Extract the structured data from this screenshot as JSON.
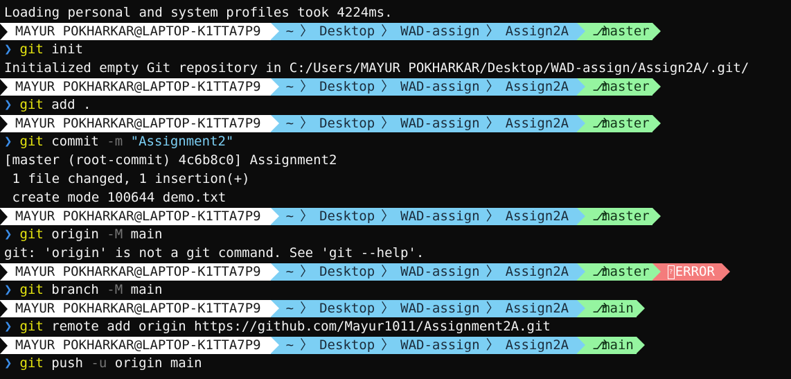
{
  "terminal": {
    "startup": "Loading personal and system profiles took 4224ms.",
    "prompt": {
      "user": "MAYUR POKHARKAR@LAPTOP-K1TTA7P9",
      "home": "~",
      "path": [
        "Desktop",
        "WAD-assign",
        "Assign2A"
      ],
      "prompt_symbol": "❯"
    },
    "colors": {
      "user_segment": "#ffffff",
      "path_segment": "#7ccff4",
      "git_segment": "#95f5a0",
      "error_segment": "#f47c7c",
      "git_command": "#e5e510",
      "prompt_chevron": "#3b8eea"
    },
    "branches": {
      "master": "master",
      "main": "main"
    },
    "error_label": "ERROR",
    "commands": {
      "c1": {
        "git": "git",
        "rest": " init"
      },
      "c2": {
        "git": "git",
        "rest": " add ."
      },
      "c3": {
        "git": "git",
        "rest": " commit ",
        "flag": "-m",
        "str": " \"Assignment2\""
      },
      "c4": {
        "git": "git",
        "rest": " origin ",
        "flag": "-M",
        "rest2": " main"
      },
      "c5": {
        "git": "git",
        "rest": " branch ",
        "flag": "-M",
        "rest2": " main"
      },
      "c6": {
        "git": "git",
        "rest": " remote add origin https://github.com/Mayur1011/Assignment2A.git"
      },
      "c7": {
        "git": "git",
        "rest": " push ",
        "flag": "-u",
        "rest2": " origin main"
      }
    },
    "outputs": {
      "init": "Initialized empty Git repository in C:/Users/MAYUR POKHARKAR/Desktop/WAD-assign/Assign2A/.git/",
      "commit1": "[master (root-commit) 4c6b8c0] Assignment2",
      "commit2": " 1 file changed, 1 insertion(+)",
      "commit3": " create mode 100644 demo.txt",
      "origin_err": "git: 'origin' is not a git command. See 'git --help'."
    }
  }
}
